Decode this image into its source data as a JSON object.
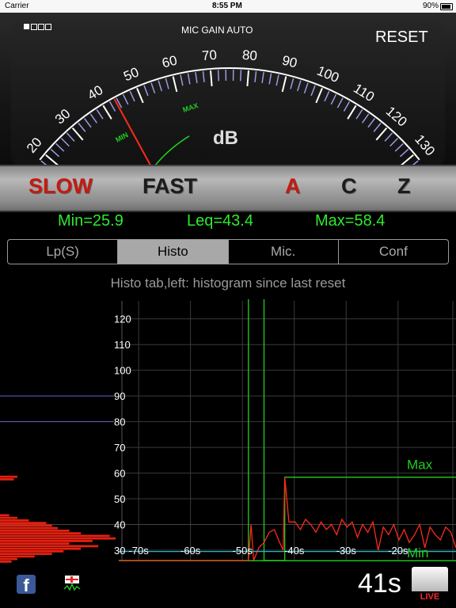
{
  "status_bar": {
    "carrier": "Carrier",
    "time": "8:55 PM",
    "battery": "90%"
  },
  "meter": {
    "mic_gain": "MIC GAIN AUTO",
    "reset": "RESET",
    "unit": "dB",
    "scale_labels": [
      "20",
      "30",
      "40",
      "50",
      "60",
      "70",
      "80",
      "90",
      "100",
      "110",
      "120",
      "130"
    ],
    "scale_values": [
      20,
      30,
      40,
      50,
      60,
      70,
      80,
      90,
      100,
      110,
      120,
      130
    ],
    "needle_value": 43.4,
    "min_label": "MIN",
    "max_label": "MAX",
    "min_value": 25.9,
    "max_value": 58.4,
    "colors": {
      "needle": "#ff2a1a",
      "minmax": "#22cc22",
      "ticks": "#9a9ae6"
    }
  },
  "modes": {
    "slow": "SLOW",
    "fast": "FAST",
    "a": "A",
    "c": "C",
    "z": "Z"
  },
  "stats": {
    "min": "Min=25.9",
    "leq": "Leq=43.4",
    "max": "Max=58.4"
  },
  "tabs": [
    "Lp(S)",
    "Histo",
    "Mic.",
    "Conf"
  ],
  "active_tab": "Histo",
  "hint": "Histo tab,left: histogram since last reset",
  "chart_data": {
    "type": "line",
    "x_ticks": [
      "-70s",
      "-60s",
      "-50s",
      "-40s",
      "-30s",
      "-20s"
    ],
    "x_tick_values": [
      -70,
      -60,
      -50,
      -40,
      -30,
      -20
    ],
    "y_ticks": [
      "30",
      "40",
      "50",
      "60",
      "70",
      "80",
      "90",
      "100",
      "110",
      "120"
    ],
    "y_tick_values": [
      30,
      40,
      50,
      60,
      70,
      80,
      90,
      100,
      110,
      120
    ],
    "xlim": [
      -72,
      -7
    ],
    "ylim": [
      26,
      127
    ],
    "series": [
      {
        "name": "Max",
        "color": "#22cc22",
        "x": [
          -72,
          -47,
          -47,
          -44,
          -44,
          -40,
          -40,
          -7
        ],
        "y": [
          26,
          26,
          128,
          128,
          26,
          26,
          58.4,
          58.4
        ]
      },
      {
        "name": "Min",
        "color": "#22cc22",
        "x": [
          -72,
          -7
        ],
        "y": [
          25.9,
          25.9
        ]
      },
      {
        "color": "#ff2a1a",
        "x": [
          -72,
          -47,
          -46.5,
          -46,
          -45,
          -44,
          -43,
          -42,
          -41,
          -40.3,
          -40,
          -39.2,
          -38,
          -37,
          -36,
          -35,
          -34,
          -33,
          -32,
          -31,
          -30,
          -29,
          -28,
          -27,
          -26,
          -25,
          -24,
          -23,
          -22,
          -21,
          -20,
          -19,
          -18,
          -17,
          -16,
          -15,
          -14,
          -13,
          -12,
          -11,
          -10,
          -9,
          -8,
          -7
        ],
        "y": [
          26,
          26,
          40,
          26,
          31,
          33,
          37,
          38,
          33,
          30,
          58.4,
          41,
          41,
          38,
          42,
          40,
          37,
          41,
          38,
          40,
          36,
          42,
          39,
          41,
          35,
          40,
          37,
          41,
          30,
          39,
          36,
          40,
          34,
          38,
          33,
          36,
          40,
          31,
          39,
          36,
          34,
          39,
          37,
          31
        ]
      },
      {
        "color": "#2ab0c8",
        "x": [
          -72,
          -7
        ],
        "y": [
          29.5,
          29.5
        ]
      }
    ],
    "labels": {
      "max": "Max",
      "min": "Min"
    },
    "histogram": {
      "color": "#e62010",
      "bins_db": [
        25,
        26,
        27,
        28,
        29,
        30,
        31,
        32,
        33,
        34,
        35,
        36,
        37,
        38,
        39,
        40,
        41,
        42,
        43,
        57,
        58
      ],
      "counts": [
        0.1,
        0.15,
        0.3,
        0.45,
        0.55,
        0.7,
        0.85,
        0.6,
        0.8,
        1.0,
        0.95,
        0.7,
        0.6,
        0.5,
        0.45,
        0.4,
        0.25,
        0.15,
        0.08,
        0.12,
        0.15
      ]
    },
    "ref_lines": [
      {
        "y": 90,
        "color": "#7a5acc"
      },
      {
        "y": 80,
        "color": "#7a5acc"
      },
      {
        "y": 40,
        "color": "#444"
      }
    ]
  },
  "bottom": {
    "timer": "41s",
    "live": "LIVE",
    "facebook_icon": "f"
  }
}
